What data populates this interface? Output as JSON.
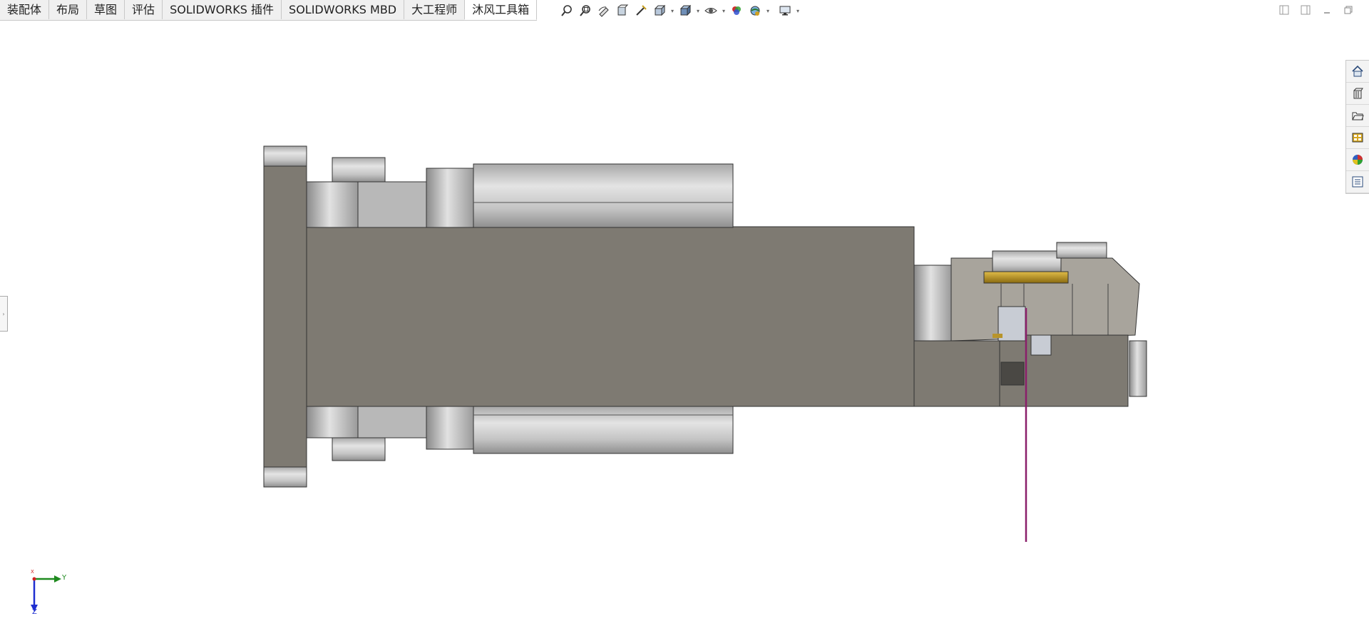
{
  "tabs": [
    {
      "label": "装配体",
      "active": false
    },
    {
      "label": "布局",
      "active": false
    },
    {
      "label": "草图",
      "active": false
    },
    {
      "label": "评估",
      "active": false
    },
    {
      "label": "SOLIDWORKS 插件",
      "active": false
    },
    {
      "label": "SOLIDWORKS MBD",
      "active": false
    },
    {
      "label": "大工程师",
      "active": false
    },
    {
      "label": "沐风工具箱",
      "active": true
    }
  ],
  "hud_icons": [
    "zoom-to-fit-icon",
    "zoom-to-area-icon",
    "previous-view-icon",
    "section-view-icon",
    "dynamic-annotation-icon",
    "view-orientation-icon",
    "display-style-icon",
    "hide-show-items-icon",
    "edit-appearance-icon",
    "apply-scene-icon",
    "view-settings-icon"
  ],
  "task_pane_icons": [
    "home-icon",
    "design-library-icon",
    "file-explorer-icon",
    "view-palette-icon",
    "appearances-icon",
    "custom-properties-icon"
  ],
  "triad": {
    "y_label": "Y",
    "z_label": "Z",
    "x_label": "X"
  },
  "colors": {
    "body_gray": "#7e7a72",
    "cylinder_light": "#d9d9d9",
    "cylinder_mid": "#b8b8b8",
    "brass": "#b8942a",
    "magenta_line": "#8a1f6a",
    "axis_y": "#1f8a1f",
    "axis_z": "#1f2fd0",
    "axis_x": "#d02020"
  }
}
